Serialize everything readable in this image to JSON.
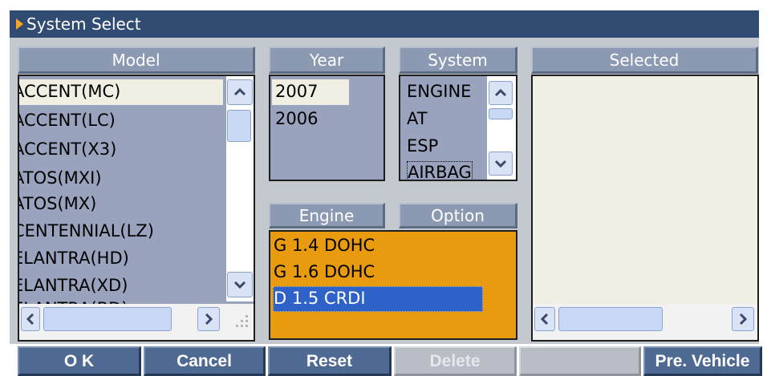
{
  "window": {
    "title": "System Select"
  },
  "headers": {
    "model": "Model",
    "year": "Year",
    "system": "System",
    "selected": "Selected",
    "engine": "Engine",
    "option": "Option"
  },
  "model_list": {
    "items": [
      "ACCENT(MC)",
      "ACCENT(LC)",
      "ACCENT(X3)",
      "ATOS(MXI)",
      "ATOS(MX)",
      "CENTENNIAL(LZ)",
      "ELANTRA(HD)",
      "ELANTRA(XD)",
      "ELANTRA(BD)"
    ],
    "selected": "ACCENT(MC)"
  },
  "year_list": {
    "items": [
      "2007",
      "2006"
    ],
    "selected": "2007"
  },
  "system_list": {
    "items": [
      "ENGINE",
      "AT",
      "ESP",
      "AIRBAG"
    ]
  },
  "engine_list": {
    "items": [
      "G 1.4 DOHC",
      "G 1.6 DOHC",
      "D 1.5 CRDI"
    ],
    "selected": "D 1.5 CRDI"
  },
  "selected_list": {
    "items": []
  },
  "buttons": {
    "ok": "O K",
    "cancel": "Cancel",
    "reset": "Reset",
    "delete": "Delete",
    "blank": "",
    "pre_vehicle": "Pre. Vehicle"
  },
  "colors": {
    "titlebar": "#314c73",
    "panel": "#c4c9d0",
    "header": "#8b9ab2",
    "list": "#9aa3bd",
    "engine_bg": "#e89b0f",
    "selection": "#2f62c9",
    "button": "#4f6a92"
  },
  "icons": {
    "title_marker": "triangle-right-icon",
    "scroll_up": "chevron-up-icon",
    "scroll_down": "chevron-down-icon",
    "scroll_left": "chevron-left-icon",
    "scroll_right": "chevron-right-icon"
  }
}
